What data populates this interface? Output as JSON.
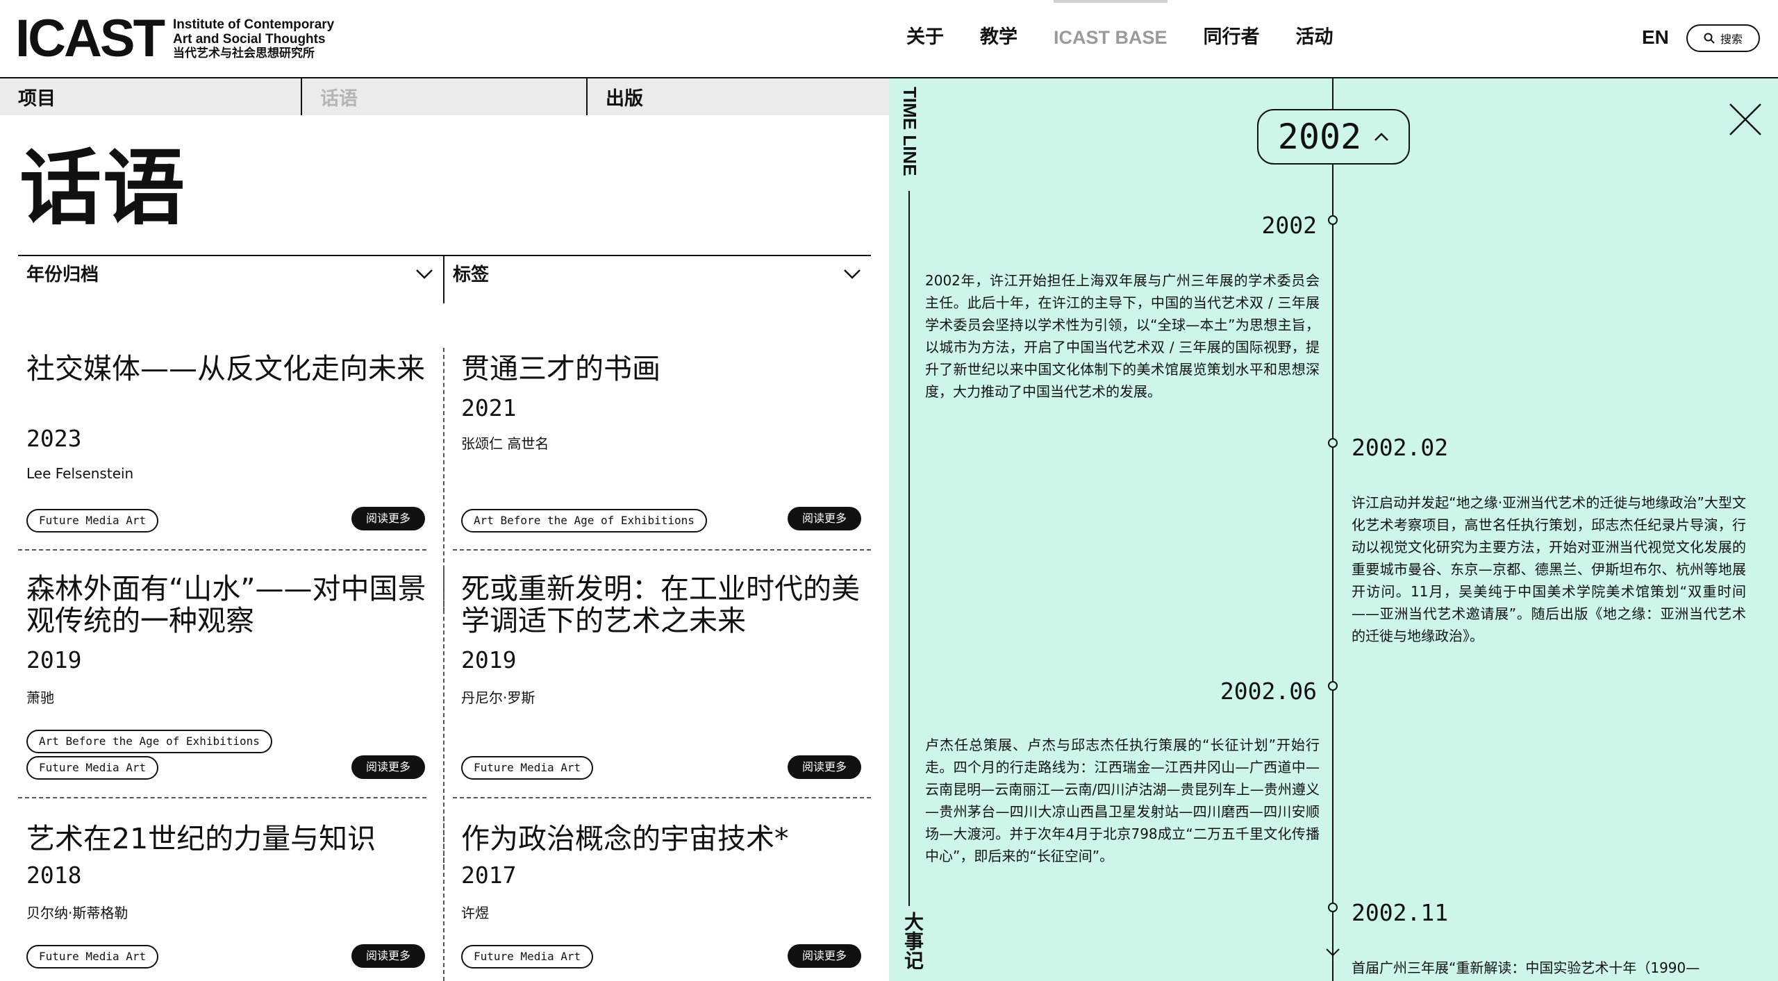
{
  "header": {
    "logo_mark": "ICAST",
    "logo_line1": "Institute of Contemporary",
    "logo_line2": "Art and Social Thoughts",
    "logo_line3": "当代艺术与社会思想研究所",
    "nav": [
      "关于",
      "教学",
      "ICAST BASE",
      "同行者",
      "活动"
    ],
    "lang": "EN",
    "search_label": "搜索"
  },
  "subtabs": [
    "项目",
    "话语",
    "出版"
  ],
  "page_title": "话语",
  "filters": {
    "year": "年份归档",
    "tags": "标签"
  },
  "cards": [
    {
      "title": "社交媒体——从反文化走向未来",
      "year": "2023",
      "author": "Lee Felsenstein",
      "tags": [
        "Future Media Art"
      ],
      "more": "阅读更多"
    },
    {
      "title": "贯通三才的书画",
      "year": "2021",
      "author": "张颂仁 高世名",
      "tags": [
        "Art Before the Age of Exhibitions"
      ],
      "more": "阅读更多"
    },
    {
      "title": "森林外面有“山水”——对中国景观传统的一种观察",
      "year": "2019",
      "author": "萧驰",
      "tags": [
        "Art Before the Age of Exhibitions",
        "Future Media Art"
      ],
      "more": "阅读更多"
    },
    {
      "title": "死或重新发明：在工业时代的美学调适下的艺术之未来",
      "year": "2019",
      "author": "丹尼尔·罗斯",
      "tags": [
        "Future Media Art"
      ],
      "more": "阅读更多"
    },
    {
      "title": "艺术在21世纪的力量与知识",
      "year": "2018",
      "author": "贝尔纳·斯蒂格勒",
      "tags": [
        "Future Media Art"
      ],
      "more": "阅读更多"
    },
    {
      "title": "作为政治概念的宇宙技术*",
      "year": "2017",
      "author": "许煜",
      "tags": [
        "Future Media Art"
      ],
      "more": "阅读更多"
    }
  ],
  "timeline": {
    "side_label_top": "TIME LINE",
    "side_label_bottom": "大事记",
    "selected_year": "2002",
    "events": [
      {
        "date": "2002",
        "text": "2002年，许江开始担任上海双年展与广州三年展的学术委员会主任。此后十年，在许江的主导下，中国的当代艺术双 / 三年展学术委员会坚持以学术性为引领，以“全球—本土”为思想主旨， 以城市为方法，开启了中国当代艺术双 / 三年展的国际视野，提升了新世纪以来中国文化体制下的美术馆展览策划水平和思想深度，大力推动了中国当代艺术的发展。"
      },
      {
        "date": "2002.02",
        "text": "许江启动并发起“地之缘·亚洲当代艺术的迁徙与地缘政治”大型文化艺术考察项目，高世名任执行策划，邱志杰任纪录片导演，行动以视觉文化研究为主要方法，开始对亚洲当代视觉文化发展的重要城市曼谷、东京—京都、德黑兰、伊斯坦布尔、杭州等地展开访问。11月，吴美纯于中国美术学院美术馆策划“双重时间——亚洲当代艺术邀请展”。随后出版《地之缘：亚洲当代艺术的迁徙与地缘政治》。"
      },
      {
        "date": "2002.06",
        "text": "卢杰任总策展、卢杰与邱志杰任执行策展的“长征计划”开始行走。四个月的行走路线为：江西瑞金—江西井冈山—广西道中—云南昆明—云南丽江—云南/四川泸沽湖—贵昆列车上—贵州遵义—贵州茅台—四川大凉山西昌卫星发射站—四川磨西—四川安顺场—大渡河。并于次年4月于北京798成立“二万五千里文化传播中心”，即后来的“长征空间”。"
      },
      {
        "date": "2002.11",
        "text": "首届广州三年展“重新解读：中国实验艺术十年（1990—"
      }
    ]
  }
}
